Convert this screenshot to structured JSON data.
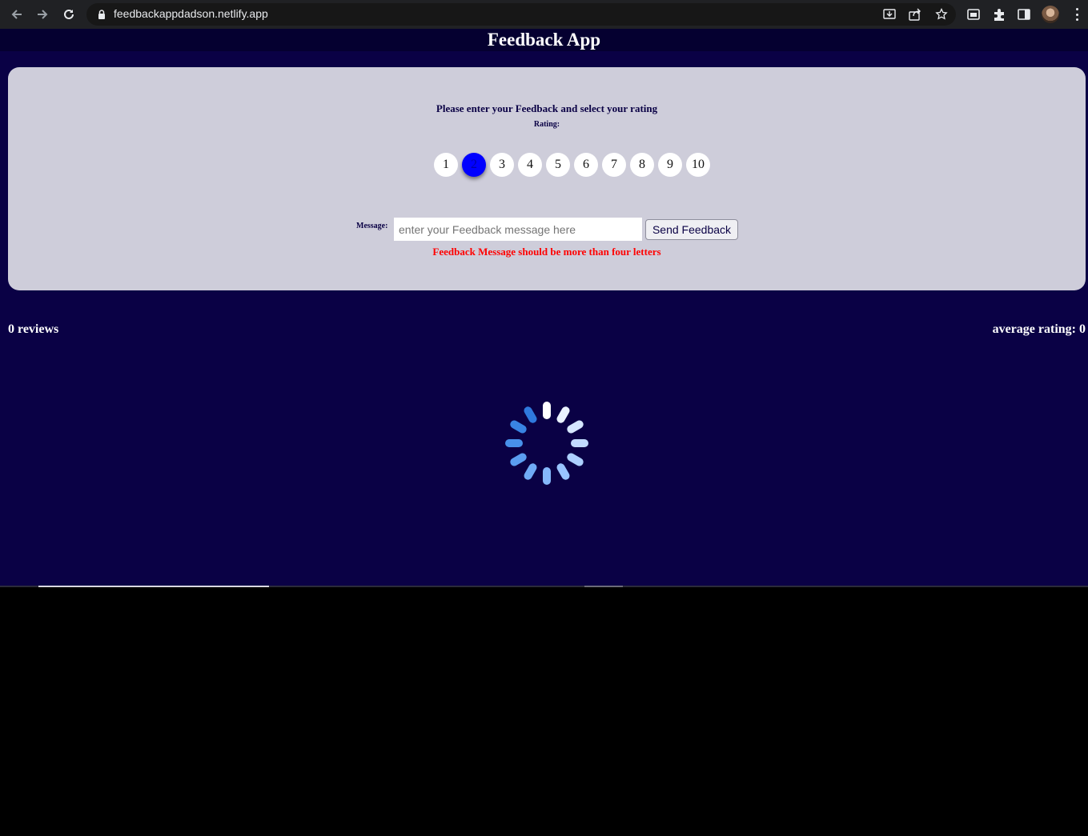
{
  "browser": {
    "url": "feedbackappdadson.netlify.app"
  },
  "app": {
    "title": "Feedback App",
    "prompt": "Please enter your Feedback and select your rating",
    "rating_label": "Rating:",
    "ratings": [
      "1",
      "2",
      "3",
      "4",
      "5",
      "6",
      "7",
      "8",
      "9",
      "10"
    ],
    "selected_rating": "2",
    "message_label": "Message:",
    "message_placeholder": "enter your Feedback message here",
    "message_value": "",
    "send_label": "Send Feedback",
    "error": "Feedback Message should be more than four letters",
    "reviews": "0 reviews",
    "average": "average rating: 0"
  },
  "colors": {
    "page_bg": "#0a0145",
    "card_bg": "#cecdda",
    "selected_rating": "#0000ff",
    "error": "#ff0000"
  },
  "icons": [
    "back-arrow-icon",
    "forward-arrow-icon",
    "reload-icon",
    "lock-icon",
    "install-icon",
    "share-icon",
    "star-icon",
    "tab-search-icon",
    "extensions-icon",
    "side-panel-icon",
    "profile-avatar",
    "menu-kebab-icon",
    "loading-spinner-icon"
  ]
}
